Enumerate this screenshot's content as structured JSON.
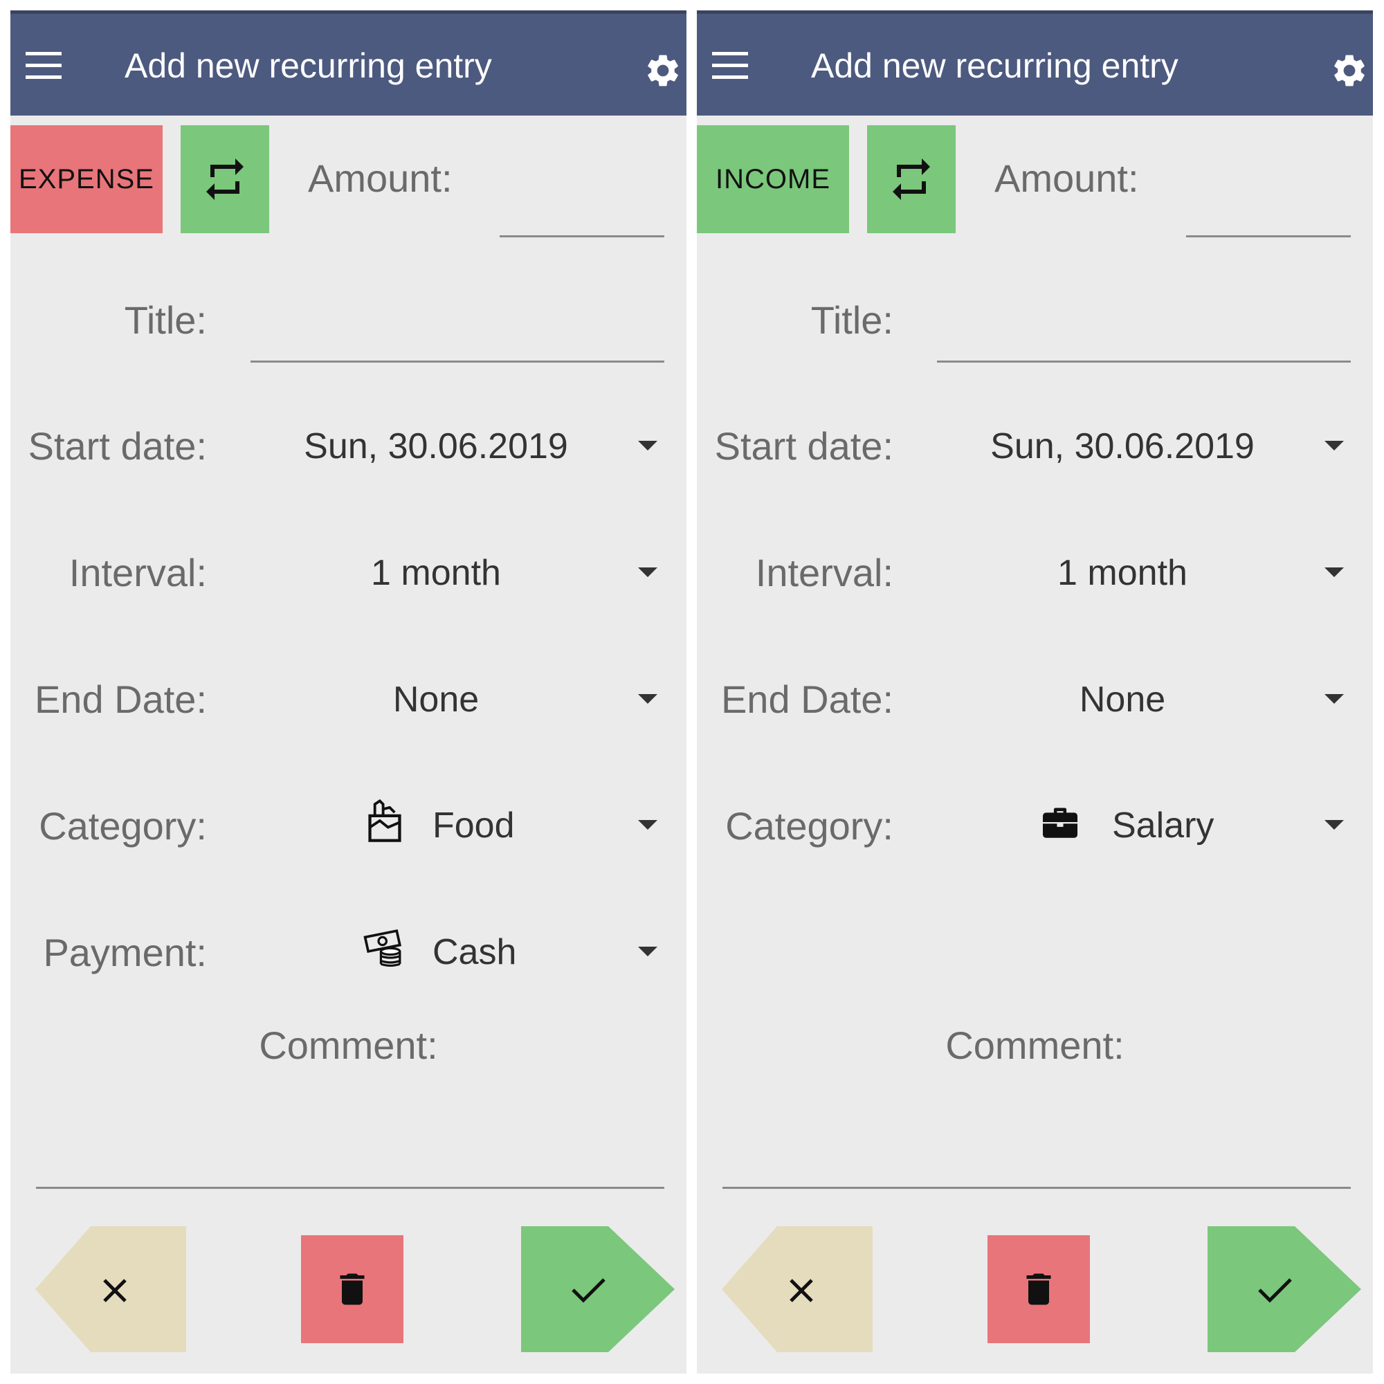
{
  "screens": [
    {
      "appbar": {
        "title": "Add new recurring entry"
      },
      "type_button": {
        "label": "EXPENSE",
        "color": "#e8757a"
      },
      "amount": {
        "label": "Amount:",
        "value": ""
      },
      "title_field": {
        "label": "Title:",
        "value": ""
      },
      "start_date": {
        "label": "Start date:",
        "value": "Sun, 30.06.2019"
      },
      "interval": {
        "label": "Interval:",
        "value": "1 month"
      },
      "end_date": {
        "label": "End Date:",
        "value": "None"
      },
      "category": {
        "label": "Category:",
        "value": "Food",
        "icon": "food-bag-icon"
      },
      "payment": {
        "label": "Payment:",
        "value": "Cash",
        "icon": "cash-icon"
      },
      "comment": {
        "label": "Comment:",
        "value": ""
      }
    },
    {
      "appbar": {
        "title": "Add new recurring entry"
      },
      "type_button": {
        "label": "INCOME",
        "color": "#7bc77c"
      },
      "amount": {
        "label": "Amount:",
        "value": ""
      },
      "title_field": {
        "label": "Title:",
        "value": ""
      },
      "start_date": {
        "label": "Start date:",
        "value": "Sun, 30.06.2019"
      },
      "interval": {
        "label": "Interval:",
        "value": "1 month"
      },
      "end_date": {
        "label": "End Date:",
        "value": "None"
      },
      "category": {
        "label": "Category:",
        "value": "Salary",
        "icon": "briefcase-icon"
      },
      "comment": {
        "label": "Comment:",
        "value": ""
      }
    }
  ],
  "colors": {
    "appbar": "#4d5a7f",
    "background": "#ebebeb",
    "green": "#7bc77c",
    "red": "#e8757a",
    "beige": "#e5dcbd"
  }
}
